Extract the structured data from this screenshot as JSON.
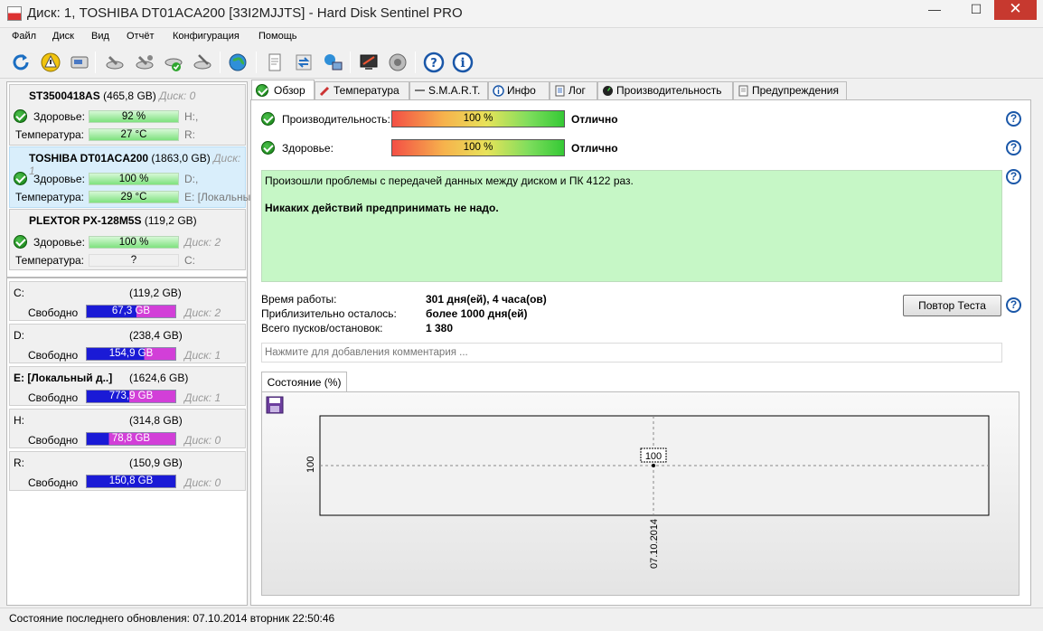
{
  "window": {
    "title": "Диск: 1, TOSHIBA DT01ACA200 [33I2MJJTS]  -  Hard Disk Sentinel  PRO",
    "minimize": "—",
    "maximize": "☐",
    "close": "✕"
  },
  "menu": [
    "Файл",
    "Диск",
    "Вид",
    "Отчёт",
    "Конфигурация",
    "Помощь"
  ],
  "toolbar": [
    "refresh-icon",
    "warning-icon",
    "disk-icon",
    "hdd-tool-icon",
    "hdd-tool2-icon",
    "hdd-check-icon",
    "hdd-wrench-icon",
    "globe-icon",
    "report-icon",
    "transfer-icon",
    "network-icon",
    "monitor-icon",
    "speaker-icon",
    "help-icon",
    "info-icon"
  ],
  "disks": [
    {
      "model": "ST3500418AS",
      "size": "(465,8 GB)",
      "disk": "Диск: 0",
      "health_label": "Здоровье:",
      "health": "92 %",
      "health_frac": 0.92,
      "health_side": "H:,",
      "temp_label": "Температура:",
      "temp": "27 °C",
      "temp_side": "R:"
    },
    {
      "model": "TOSHIBA DT01ACA200",
      "size": "(1863,0 GB)",
      "disk": "Диск: 1",
      "health_label": "Здоровье:",
      "health": "100 %",
      "health_frac": 1.0,
      "health_side": "D:,",
      "temp_label": "Температура:",
      "temp": "29 °C",
      "temp_side": "E: [Локальный"
    },
    {
      "model": "PLEXTOR PX-128M5S",
      "size": "(119,2 GB)",
      "disk": "",
      "health_label": "Здоровье:",
      "health": "100 %",
      "health_frac": 1.0,
      "health_side": "Диск: 2",
      "temp_label": "Температура:",
      "temp": "?",
      "temp_side": "C:"
    }
  ],
  "volumes": [
    {
      "name": "C:",
      "size": "(119,2 GB)",
      "free_label": "Свободно",
      "free": "67,3 GB",
      "free_frac": 0.565,
      "disk": "Диск: 2"
    },
    {
      "name": "D:",
      "size": "(238,4 GB)",
      "free_label": "Свободно",
      "free": "154,9 GB",
      "free_frac": 0.65,
      "disk": "Диск: 1"
    },
    {
      "name": "E: [Локальный д..]",
      "size": "(1624,6 GB)",
      "free_label": "Свободно",
      "free": "773,9 GB",
      "free_frac": 0.476,
      "disk": "Диск: 1"
    },
    {
      "name": "H:",
      "size": "(314,8 GB)",
      "free_label": "Свободно",
      "free": "78,8 GB",
      "free_frac": 0.25,
      "disk": "Диск: 0"
    },
    {
      "name": "R:",
      "size": "(150,9 GB)",
      "free_label": "Свободно",
      "free": "150,8 GB",
      "free_frac": 0.999,
      "disk": "Диск: 0"
    }
  ],
  "tabs": [
    "Обзор",
    "Температура",
    "S.M.A.R.T.",
    "Инфо",
    "Лог",
    "Производительность",
    "Предупреждения"
  ],
  "overview": {
    "perf_label": "Производительность:",
    "perf_value": "100 %",
    "perf_frac": 1.0,
    "perf_status": "Отлично",
    "health_label": "Здоровье:",
    "health_value": "100 %",
    "health_frac": 1.0,
    "health_status": "Отлично",
    "msg1": "Произошли проблемы с передачей данных между диском и ПК 4122 раз.",
    "msg2": "Никаких действий предпринимать не надо.",
    "uptime_label": "Время работы:",
    "uptime": "301 дня(ей), 4 часа(ов)",
    "remain_label": "Приблизительно осталось:",
    "remain": "более 1000 дня(ей)",
    "starts_label": "Всего пусков/остановок:",
    "starts": "1 380",
    "retest": "Повтор Теста",
    "comment_placeholder": "Нажмите для добавления комментария ...",
    "state_tab": "Состояние (%)"
  },
  "chart_data": {
    "type": "line",
    "x": [
      "07.10.2014"
    ],
    "values": [
      100
    ],
    "data_labels": [
      "100"
    ],
    "ytick": "100",
    "xtick": "07.10.2014"
  },
  "status": "Состояние последнего обновления: 07.10.2014 вторник 22:50:46"
}
